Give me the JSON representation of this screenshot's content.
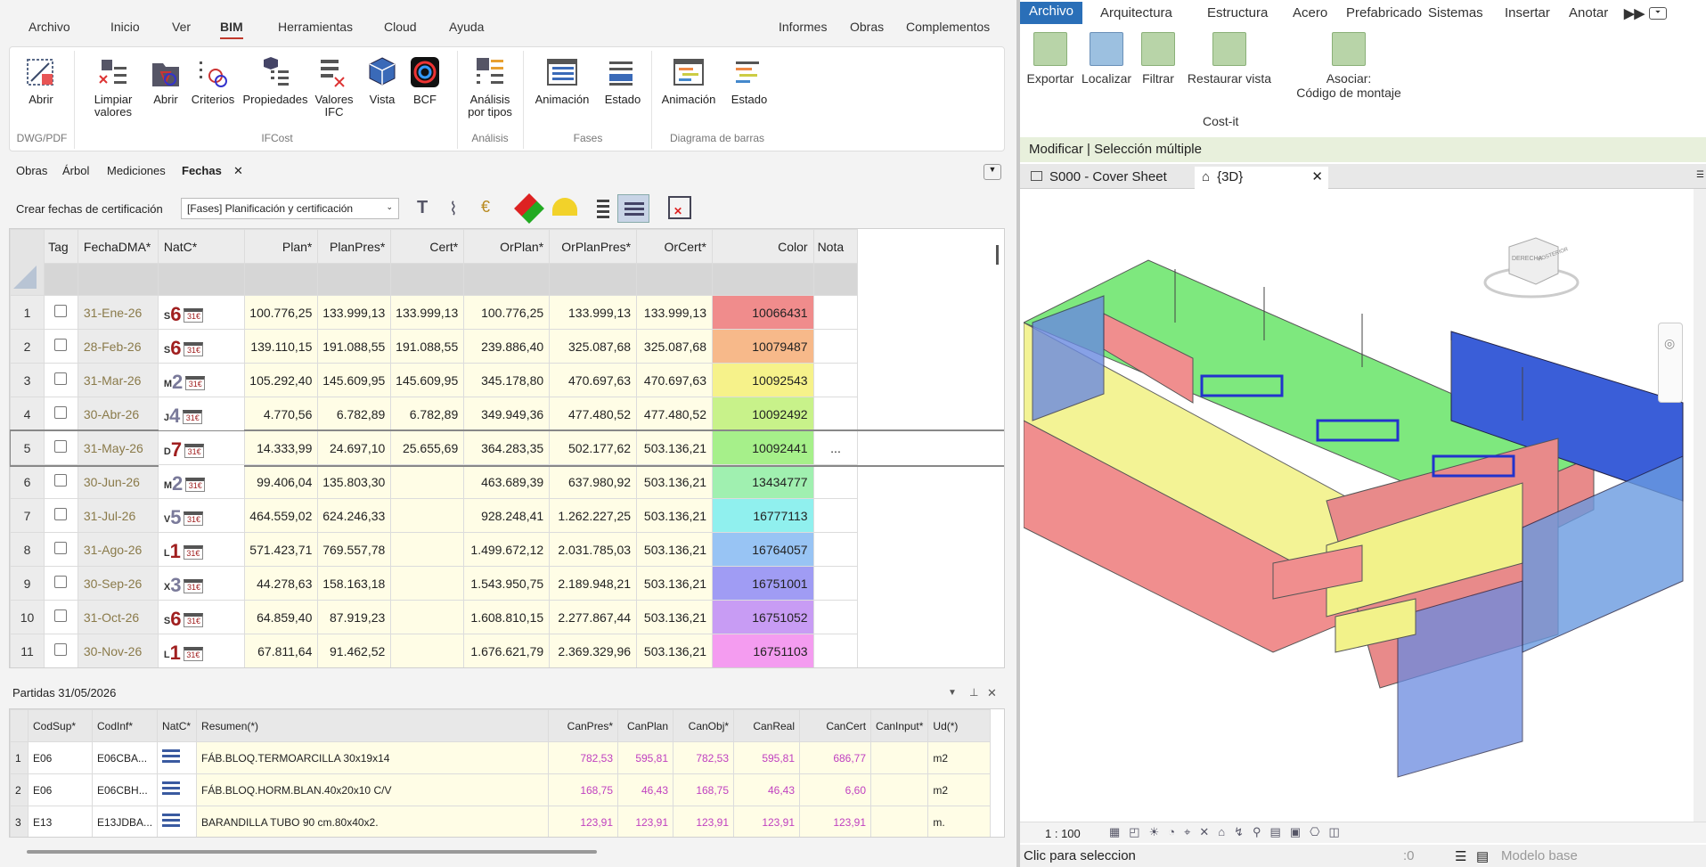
{
  "menu": {
    "archivo": "Archivo",
    "inicio": "Inicio",
    "ver": "Ver",
    "bim": "BIM",
    "herramientas": "Herramientas",
    "cloud": "Cloud",
    "ayuda": "Ayuda",
    "informes": "Informes",
    "obras": "Obras",
    "complementos": "Complementos"
  },
  "ribbon": {
    "abrir_dwg": "Abrir",
    "grp_dwg": "DWG/PDF",
    "limpiar": "Limpiar valores",
    "abrir": "Abrir",
    "criterios": "Criterios",
    "propiedades": "Propiedades",
    "valores_ifc": "Valores IFC",
    "vista": "Vista",
    "bcf": "BCF",
    "grp_ifc": "IFCost",
    "analisis": "Análisis por tipos",
    "grp_analisis": "Análisis",
    "animacion": "Animación",
    "estado": "Estado",
    "grp_fases": "Fases",
    "animacion2": "Animación",
    "estado2": "Estado",
    "grp_diag": "Diagrama de barras"
  },
  "tabs": {
    "obras": "Obras",
    "arbol": "Árbol",
    "mediciones": "Mediciones",
    "fechas": "Fechas",
    "close": "✕"
  },
  "toolbar": {
    "crear": "Crear fechas de certificación",
    "select": "[Fases] Planificación y certificación"
  },
  "grid": {
    "headers": [
      "Tag",
      "FechaDMA*",
      "NatC*",
      "Plan*",
      "PlanPres*",
      "Cert*",
      "OrPlan*",
      "OrPlanPres*",
      "OrCert*",
      "Color",
      "Nota"
    ],
    "rows": [
      {
        "n": "1",
        "date": "31-Ene-26",
        "l": "S",
        "d": "6",
        "plan": "100.776,25",
        "planpres": "133.999,13",
        "cert": "133.999,13",
        "orplan": "100.776,25",
        "orplanpres": "133.999,13",
        "orcert": "133.999,13",
        "color": "10066431",
        "bg": "#f08c8c",
        "nc": "#a01f1f"
      },
      {
        "n": "2",
        "date": "28-Feb-26",
        "l": "S",
        "d": "6",
        "plan": "139.110,15",
        "planpres": "191.088,55",
        "cert": "191.088,55",
        "orplan": "239.886,40",
        "orplanpres": "325.087,68",
        "orcert": "325.087,68",
        "color": "10079487",
        "bg": "#f7b98a",
        "nc": "#a01f1f"
      },
      {
        "n": "3",
        "date": "31-Mar-26",
        "l": "M",
        "d": "2",
        "plan": "105.292,40",
        "planpres": "145.609,95",
        "cert": "145.609,95",
        "orplan": "345.178,80",
        "orplanpres": "470.697,63",
        "orcert": "470.697,63",
        "color": "10092543",
        "bg": "#f6f28a",
        "nc": "#7a7a9a"
      },
      {
        "n": "4",
        "date": "30-Abr-26",
        "l": "J",
        "d": "4",
        "plan": "4.770,56",
        "planpres": "6.782,89",
        "cert": "6.782,89",
        "orplan": "349.949,36",
        "orplanpres": "477.480,52",
        "orcert": "477.480,52",
        "color": "10092492",
        "bg": "#c8f28a",
        "nc": "#7a7a9a"
      },
      {
        "n": "5",
        "date": "31-May-26",
        "l": "D",
        "d": "7",
        "plan": "14.333,99",
        "planpres": "24.697,10",
        "cert": "25.655,69",
        "orplan": "364.283,35",
        "orplanpres": "502.177,62",
        "orcert": "503.136,21",
        "color": "10092441",
        "bg": "#a6f08a",
        "nc": "#a01f1f",
        "nota": "..."
      },
      {
        "n": "6",
        "date": "30-Jun-26",
        "l": "M",
        "d": "2",
        "plan": "99.406,04",
        "planpres": "135.803,30",
        "cert": "",
        "orplan": "463.689,39",
        "orplanpres": "637.980,92",
        "orcert": "503.136,21",
        "color": "13434777",
        "bg": "#a0f0b0",
        "nc": "#7a7a9a"
      },
      {
        "n": "7",
        "date": "31-Jul-26",
        "l": "V",
        "d": "5",
        "plan": "464.559,02",
        "planpres": "624.246,33",
        "cert": "",
        "orplan": "928.248,41",
        "orplanpres": "1.262.227,25",
        "orcert": "503.136,21",
        "color": "16777113",
        "bg": "#90f0ee",
        "nc": "#7a7a9a"
      },
      {
        "n": "8",
        "date": "31-Ago-26",
        "l": "L",
        "d": "1",
        "plan": "571.423,71",
        "planpres": "769.557,78",
        "cert": "",
        "orplan": "1.499.672,12",
        "orplanpres": "2.031.785,03",
        "orcert": "503.136,21",
        "color": "16764057",
        "bg": "#98c4f4",
        "nc": "#a01f1f"
      },
      {
        "n": "9",
        "date": "30-Sep-26",
        "l": "X",
        "d": "3",
        "plan": "44.278,63",
        "planpres": "158.163,18",
        "cert": "",
        "orplan": "1.543.950,75",
        "orplanpres": "2.189.948,21",
        "orcert": "503.136,21",
        "color": "16751001",
        "bg": "#a09cf4",
        "nc": "#7a7a9a"
      },
      {
        "n": "10",
        "date": "31-Oct-26",
        "l": "S",
        "d": "6",
        "plan": "64.859,40",
        "planpres": "87.919,23",
        "cert": "",
        "orplan": "1.608.810,15",
        "orplanpres": "2.277.867,44",
        "orcert": "503.136,21",
        "color": "16751052",
        "bg": "#c89cf4",
        "nc": "#a01f1f"
      },
      {
        "n": "11",
        "date": "30-Nov-26",
        "l": "L",
        "d": "1",
        "plan": "67.811,64",
        "planpres": "91.462,52",
        "cert": "",
        "orplan": "1.676.621,79",
        "orplanpres": "2.369.329,96",
        "orcert": "503.136,21",
        "color": "16751103",
        "bg": "#f49cf0",
        "nc": "#a01f1f"
      }
    ]
  },
  "partidas": {
    "title": "Partidas 31/05/2026",
    "headers": [
      "CodSup*",
      "CodInf*",
      "NatC*",
      "Resumen(*)",
      "CanPres*",
      "CanPlan",
      "CanObj*",
      "CanReal",
      "CanCert",
      "CanInput*",
      "Ud(*)"
    ],
    "rows": [
      {
        "n": "1",
        "sup": "E06",
        "inf": "E06CBA...",
        "res": "FÁB.BLOQ.TERMOARCILLA 30x19x14",
        "pres": "782,53",
        "plan": "595,81",
        "obj": "782,53",
        "real": "595,81",
        "cert": "686,77",
        "ud": "m2"
      },
      {
        "n": "2",
        "sup": "E06",
        "inf": "E06CBH...",
        "res": "FÁB.BLOQ.HORM.BLAN.40x20x10 C/V",
        "pres": "168,75",
        "plan": "46,43",
        "obj": "168,75",
        "real": "46,43",
        "cert": "6,60",
        "ud": "m2"
      },
      {
        "n": "3",
        "sup": "E13",
        "inf": "E13JDBA...",
        "res": "BARANDILLA TUBO 90 cm.80x40x2.",
        "pres": "123,91",
        "plan": "123,91",
        "obj": "123,91",
        "real": "123,91",
        "cert": "123,91",
        "ud": "m."
      }
    ]
  },
  "rmenu": {
    "archivo": "Archivo",
    "arq": "Arquitectura",
    "estr": "Estructura",
    "acero": "Acero",
    "pref": "Prefabricado",
    "sist": "Sistemas",
    "ins": "Insertar",
    "anotar": "Anotar"
  },
  "rribbon": {
    "exportar": "Exportar",
    "localizar": "Localizar",
    "filtrar": "Filtrar",
    "restaurar": "Restaurar vista",
    "asociar": "Asociar:",
    "codigo": "Código de montaje",
    "grp": "Cost-it"
  },
  "modif": "Modificar | Selección múltiple",
  "vtabs": {
    "sheet": "S000 - Cover Sheet",
    "d3": "{3D}"
  },
  "viewcube": {
    "derecha": "DERECHA",
    "posterior": "POSTERIOR"
  },
  "vbar": {
    "scale": "1 : 100"
  },
  "status": {
    "msg": "Clic para seleccion",
    "zero": ":0",
    "modelo": "Modelo base"
  }
}
